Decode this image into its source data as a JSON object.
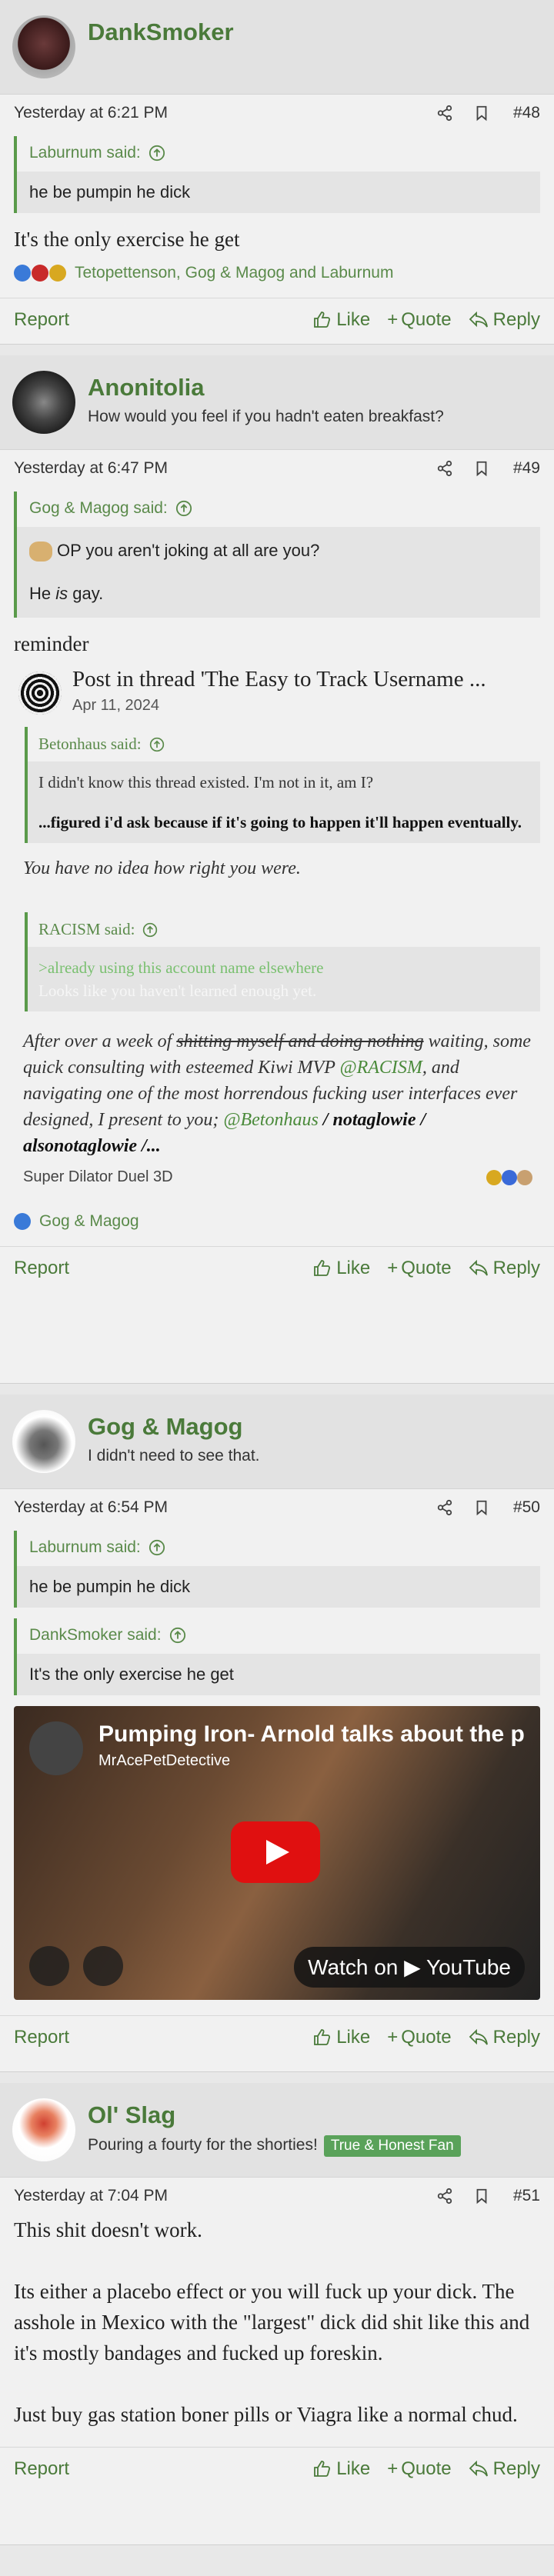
{
  "posts": [
    {
      "username": "DankSmoker",
      "date": "Yesterday at 6:21 PM",
      "number": "#48",
      "quotes": [
        {
          "author": "Laburnum said:",
          "text": "he be pumpin he dick"
        }
      ],
      "text": "It's the only exercise he get",
      "reactions": "Tetopettenson, Gog & Magog and Laburnum"
    },
    {
      "username": "Anonitolia",
      "usertitle": "How would you feel if you hadn't eaten breakfast?",
      "date": "Yesterday at 6:47 PM",
      "number": "#49",
      "quote_author": "Gog & Magog said:",
      "quote_line1": "OP you aren't joking at all are you?",
      "quote_line2_pre": "He ",
      "quote_line2_em": "is",
      "quote_line2_post": " gay.",
      "text": "reminder",
      "embed": {
        "title": "Post in thread 'The Easy to Track Username ...",
        "date": "Apr 11, 2024",
        "quote1_author": "Betonhaus said:",
        "quote1_line1": "I didn't know this thread existed. I'm not in it, am I?",
        "quote1_line2": "...figured i'd ask because if it's going to happen it'll happen eventually.",
        "line1": "You have no idea how right you were.",
        "quote2_author": "RACISM said:",
        "quote2_line1": ">already using this account name elsewhere",
        "quote2_line2": "Looks like you haven't learned enough yet.",
        "para_pre": "After over a week of ",
        "para_strike": "shitting myself and doing nothing",
        "para_mid1": " waiting, some quick consulting with esteemed Kiwi MVP ",
        "para_mention1": "@RACISM",
        "para_mid2": ", and navigating one of the most horrendous fucking user interfaces ever designed, I present to you; ",
        "para_mention2": "@Betonhaus",
        "para_bold": " / notaglowie / alsonotaglowie /...",
        "footer": "Super Dilator Duel 3D"
      },
      "reactions": "Gog & Magog"
    },
    {
      "username": "Gog & Magog",
      "usertitle": "I didn't need to see that.",
      "date": "Yesterday at 6:54 PM",
      "number": "#50",
      "quotes": [
        {
          "author": "Laburnum said:",
          "text": "he be pumpin he dick"
        },
        {
          "author": "DankSmoker said:",
          "text": "It's the only exercise he get"
        }
      ],
      "video": {
        "title": "Pumping Iron- Arnold talks about the p",
        "channel": "MrAcePetDetective",
        "watch": "Watch on ▶ YouTube"
      }
    },
    {
      "username": "Ol' Slag",
      "usertitle": "Pouring a fourty for the shorties!",
      "badge": "True & Honest Fan",
      "date": "Yesterday at 7:04 PM",
      "number": "#51",
      "para1": "This shit doesn't work.",
      "para2": "Its either a placebo effect or you will fuck up your dick. The asshole in Mexico with the \"largest\" dick did shit like this and it's mostly bandages and fucked up foreskin.",
      "para3": "Just buy gas station boner pills or Viagra like a normal chud."
    }
  ],
  "actions": {
    "report": "Report",
    "like": "Like",
    "quote": "Quote",
    "reply": "Reply"
  },
  "colors": {
    "accent": "#4a7a3a",
    "quote_border": "#5a9a4a",
    "badge": "#5aa25a"
  }
}
